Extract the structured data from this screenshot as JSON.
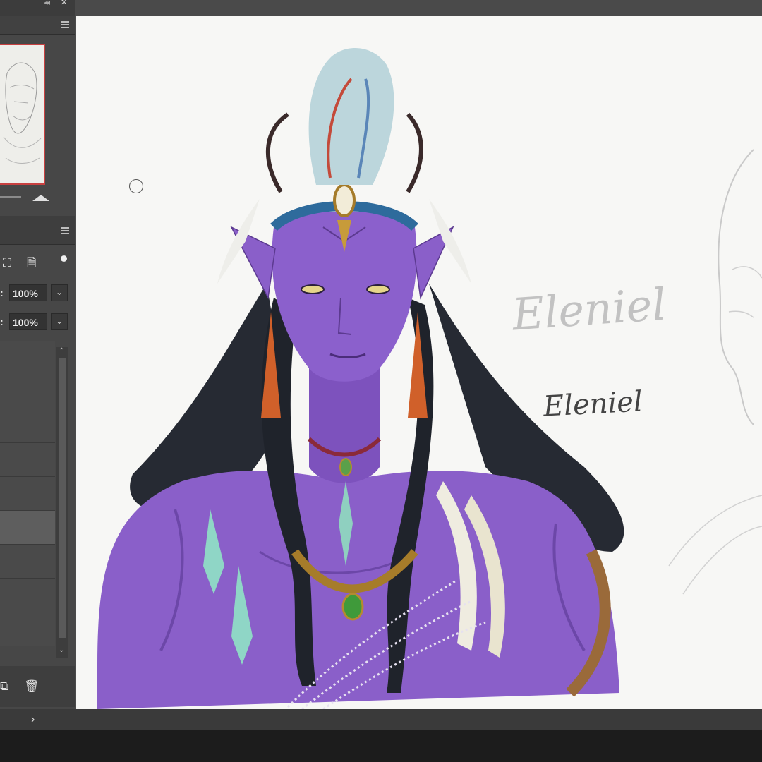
{
  "layers_panel": {
    "opacity_value": "100%",
    "fill_value": "100%"
  },
  "canvas": {
    "signature_sketch": "Eleniel",
    "signature_ink": "Eleniel"
  },
  "colors": {
    "canvas_bg": "#f7f7f5",
    "skin": "#8a5fc9",
    "hair": "#262a33",
    "panel": "#474747",
    "selection_outline": "#c84040"
  },
  "icons": {
    "close": "close-icon",
    "panel_menu": "hamburger-menu-icon",
    "zoom": "mountain-icon",
    "transform": "transform-icon",
    "lock": "lock-icon",
    "delete": "trash-icon",
    "new_layer": "new-layer-icon",
    "expand": "chevron-right-icon"
  }
}
